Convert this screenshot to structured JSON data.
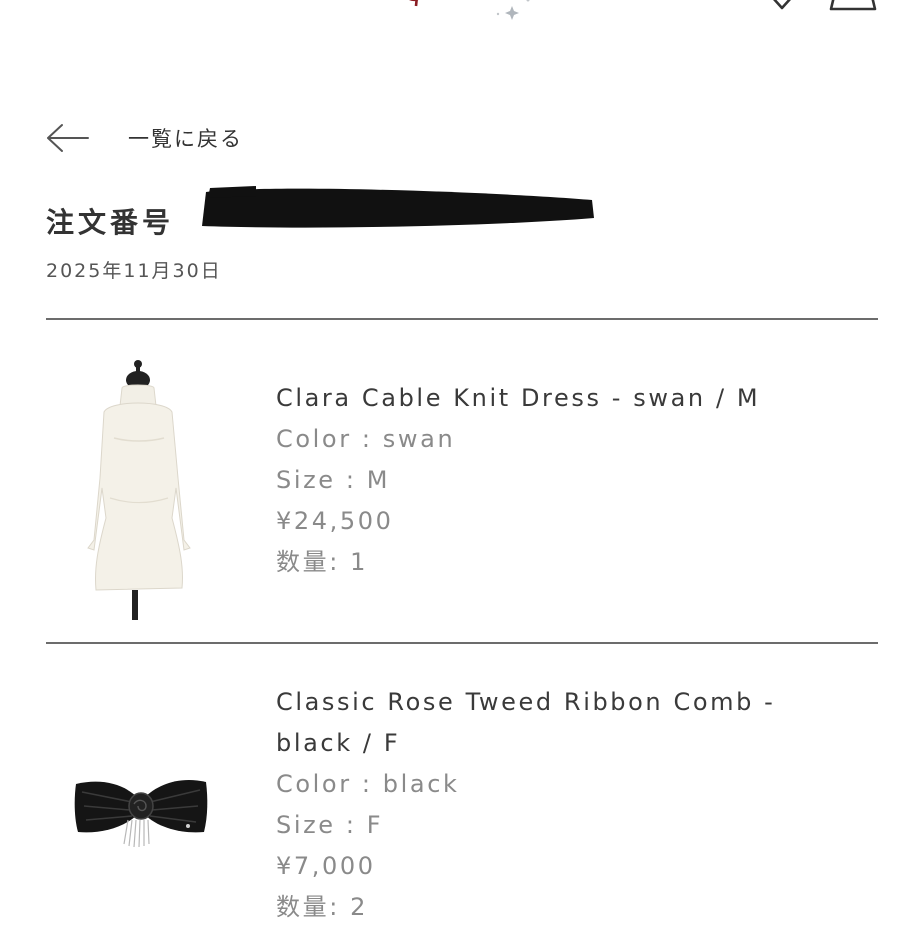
{
  "header": {
    "menu_icon": "menu-icon",
    "logo": "brand-logo",
    "favorite_icon": "heart-icon",
    "cart_icon": "cart-icon"
  },
  "back": {
    "icon": "arrow-left-icon",
    "label": "一覧に戻る"
  },
  "order": {
    "number_label": "注文番号",
    "date": "2025年11月30日"
  },
  "items": [
    {
      "image": "cream-knit-dress-image",
      "name": "Clara Cable Knit Dress - swan / M",
      "color": "Color : swan",
      "size": "Size : M",
      "price": "¥24,500",
      "quantity": "数量: 1"
    },
    {
      "image": "black-ribbon-comb-image",
      "name_line1": "Classic Rose Tweed Ribbon Comb -",
      "name_line2": "black / F",
      "color": "Color : black",
      "size": "Size : F",
      "price": "¥7,000",
      "quantity": "数量: 2"
    }
  ],
  "colors": {
    "text": "#3a3a3a",
    "muted": "#8a8a8a",
    "divider": "#6c6c6c",
    "logo_accent": "#8a1c22"
  }
}
